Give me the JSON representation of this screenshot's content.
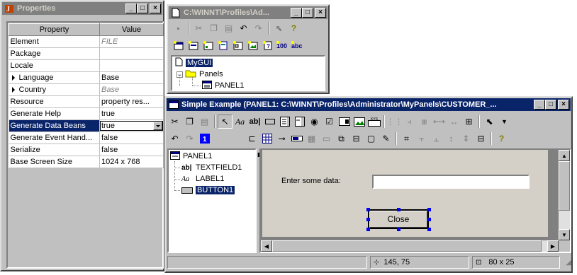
{
  "properties_window": {
    "title": "Properties",
    "col_property": "Property",
    "col_value": "Value",
    "rows": [
      {
        "name": "Element",
        "value": "FILE",
        "style": "italic",
        "arrow": false
      },
      {
        "name": "Package",
        "value": "",
        "style": "normal",
        "arrow": false
      },
      {
        "name": "Locale",
        "value": "",
        "style": "normal",
        "arrow": false
      },
      {
        "name": "Language",
        "value": "Base",
        "style": "normal",
        "arrow": true
      },
      {
        "name": "Country",
        "value": "Base",
        "style": "italic",
        "arrow": true
      },
      {
        "name": "Resource",
        "value": "property res...",
        "style": "normal",
        "arrow": false
      },
      {
        "name": "Generate Help",
        "value": "true",
        "style": "normal",
        "arrow": false
      },
      {
        "name": "Generate Data Beans",
        "value": "true",
        "style": "dropdown",
        "arrow": false
      },
      {
        "name": "Generate Event Hand...",
        "value": "false",
        "style": "normal",
        "arrow": false
      },
      {
        "name": "Serialize",
        "value": "false",
        "style": "normal",
        "arrow": false
      },
      {
        "name": "Base Screen Size",
        "value": "1024 x 768",
        "style": "normal",
        "arrow": false
      }
    ]
  },
  "file_window": {
    "title": "C:\\WINNT\\Profiles\\Ad...",
    "tree": {
      "root": "MyGUI",
      "folder": "Panels",
      "panel": "PANEL1"
    }
  },
  "editor_window": {
    "title": "Simple Example (PANEL1: C:\\WINNT\\Profiles\\Administrator\\MyPanels\\CUSTOMER_...",
    "tree": {
      "root": "PANEL1",
      "items": [
        {
          "icon": "ab|",
          "label": "TEXTFIELD1"
        },
        {
          "icon": "Aa",
          "label": "LABEL1"
        },
        {
          "icon": "btn",
          "label": "BUTTON1"
        }
      ]
    },
    "canvas": {
      "label_text": "Enter some data:",
      "textfield_value": "",
      "button_label": "Close"
    },
    "status": {
      "position": "145, 75",
      "size": "80 x 25"
    }
  },
  "colors": {
    "title_active": "#0a246a",
    "title_inactive": "#808080",
    "face": "#c0c0c0",
    "selection_handle": "#0000ff"
  }
}
